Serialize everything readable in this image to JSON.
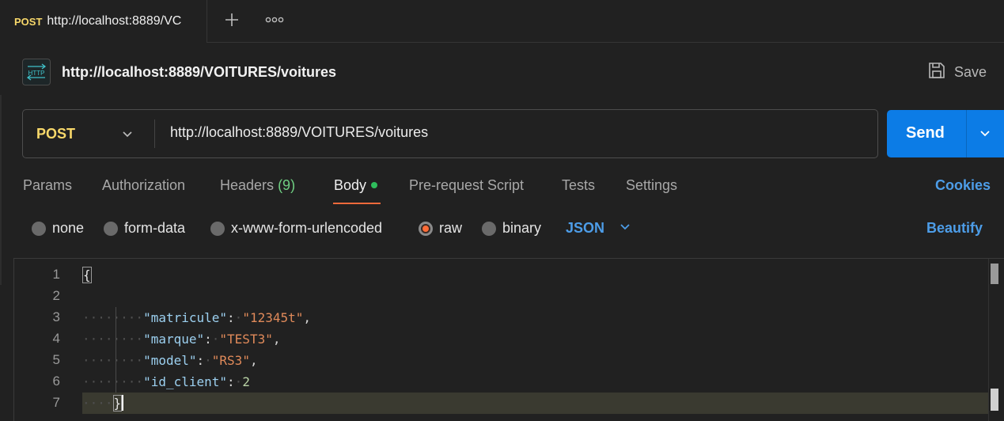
{
  "tabbar": {
    "tab_method": "POST",
    "tab_url": "http://localhost:8889/VC",
    "new_tab_icon": "plus-icon",
    "more_icon": "ellipsis-icon"
  },
  "request": {
    "badge_text": "HTTP",
    "name": "http://localhost:8889/VOITURES/voitures",
    "save_label": "Save"
  },
  "urlbar": {
    "method": "POST",
    "url": "http://localhost:8889/VOITURES/voitures",
    "send_label": "Send"
  },
  "request_tabs": {
    "params": "Params",
    "authorization": "Authorization",
    "headers": "Headers",
    "headers_count": "(9)",
    "body": "Body",
    "prerequest": "Pre-request Script",
    "tests": "Tests",
    "settings": "Settings",
    "cookies": "Cookies"
  },
  "body_types": {
    "none": "none",
    "form_data": "form-data",
    "urlencoded": "x-www-form-urlencoded",
    "raw": "raw",
    "binary": "binary",
    "selected": "raw",
    "format": "JSON",
    "beautify": "Beautify"
  },
  "editor": {
    "line_numbers": [
      "1",
      "2",
      "3",
      "4",
      "5",
      "6",
      "7"
    ],
    "open_brace": "{",
    "close_brace": "}",
    "fields": [
      {
        "key": "\"matricule\"",
        "value": "\"12345t\"",
        "trail": ","
      },
      {
        "key": "\"marque\"",
        "value": "\"TEST3\"",
        "trail": ","
      },
      {
        "key": "\"model\"",
        "value": "\"RS3\"",
        "trail": ","
      },
      {
        "key": "\"id_client\"",
        "value": "2",
        "trail": ""
      }
    ]
  },
  "colors": {
    "accent_orange": "#ff6c37",
    "send_blue": "#0c7ce6",
    "link_blue": "#4d9de8",
    "method_yellow": "#f8d86a"
  }
}
